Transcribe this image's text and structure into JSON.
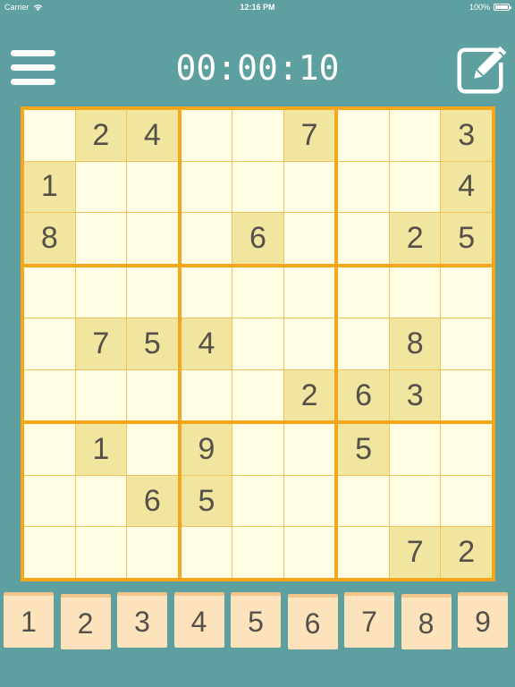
{
  "status_bar": {
    "carrier": "Carrier",
    "time": "12:16 PM",
    "battery": "100%"
  },
  "header": {
    "timer": "00:00:10"
  },
  "board": {
    "grid": [
      [
        null,
        2,
        4,
        null,
        null,
        7,
        null,
        null,
        3
      ],
      [
        1,
        null,
        null,
        null,
        null,
        null,
        null,
        null,
        4
      ],
      [
        8,
        null,
        null,
        null,
        6,
        null,
        null,
        2,
        5
      ],
      [
        null,
        null,
        null,
        null,
        null,
        null,
        null,
        null,
        null
      ],
      [
        null,
        7,
        5,
        4,
        null,
        null,
        null,
        8,
        null
      ],
      [
        null,
        null,
        null,
        null,
        null,
        2,
        6,
        3,
        null
      ],
      [
        null,
        1,
        null,
        9,
        null,
        null,
        5,
        null,
        null
      ],
      [
        null,
        null,
        6,
        5,
        null,
        null,
        null,
        null,
        null
      ],
      [
        null,
        null,
        null,
        null,
        null,
        null,
        null,
        7,
        2
      ]
    ]
  },
  "number_pad": [
    "1",
    "2",
    "3",
    "4",
    "5",
    "6",
    "7",
    "8",
    "9"
  ],
  "colors": {
    "background": "#5e9fa0",
    "board_border": "#f4a61d",
    "cell": "#fffde3",
    "given_cell": "#f0e6a0",
    "key": "#fde3bc",
    "digit": "#555049"
  },
  "icons": {
    "menu": "hamburger-menu-icon",
    "edit": "pencil-edit-icon"
  }
}
